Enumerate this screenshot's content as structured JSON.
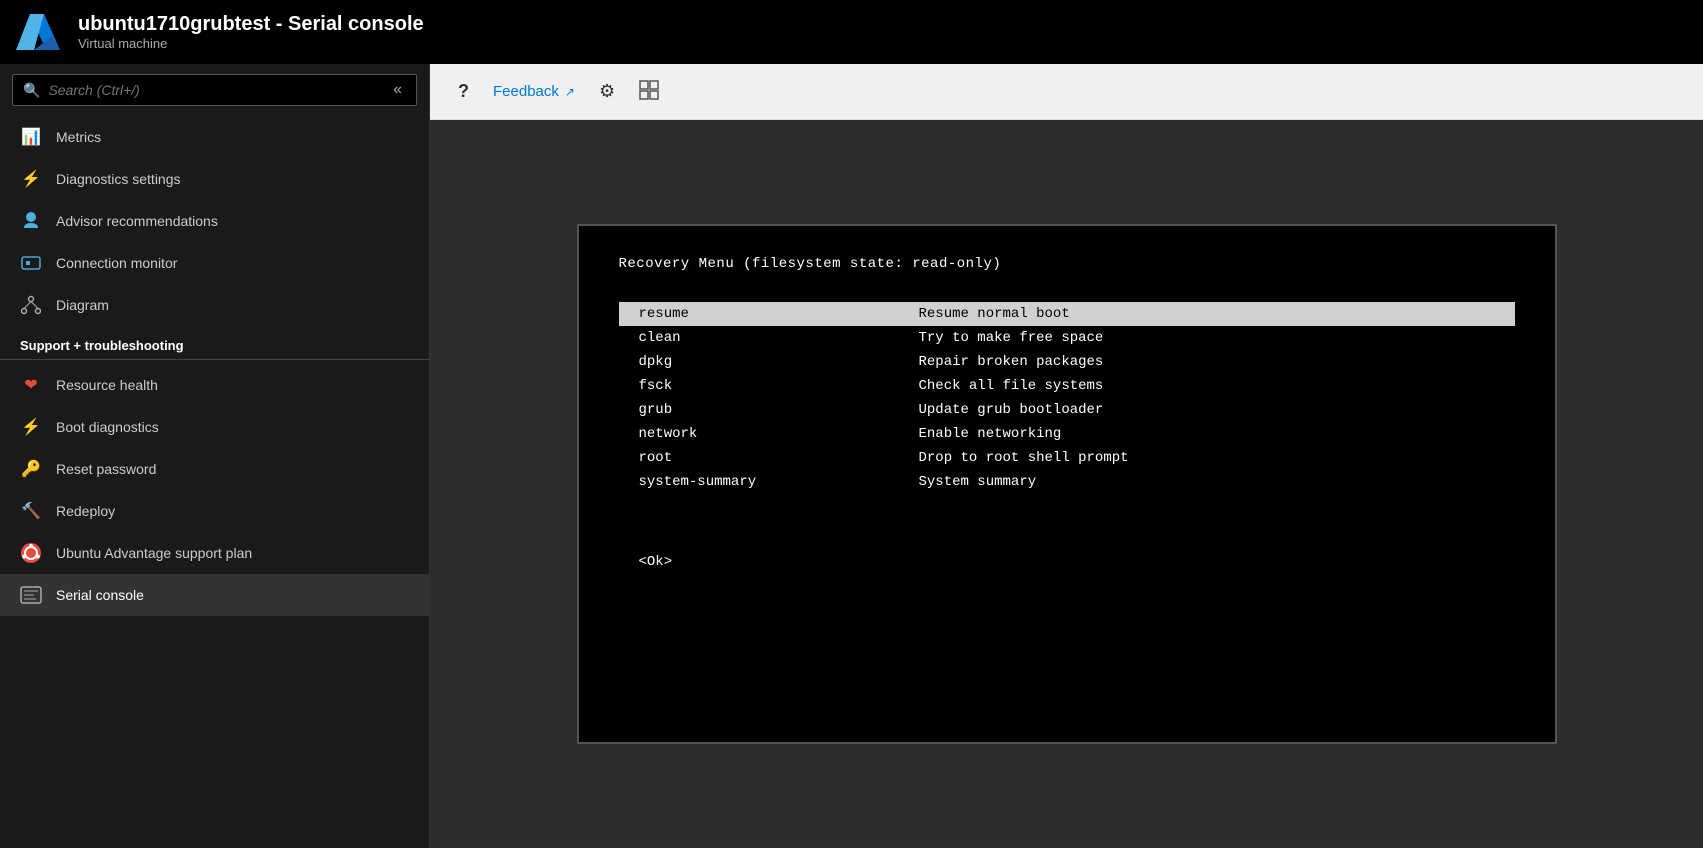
{
  "titleBar": {
    "title": "ubuntu1710grubtest - Serial console",
    "subtitle": "Virtual machine"
  },
  "toolbar": {
    "help_label": "?",
    "feedback_label": "Feedback",
    "settings_icon": "⚙",
    "grid_icon": "⊞"
  },
  "sidebar": {
    "search_placeholder": "Search (Ctrl+/)",
    "items": [
      {
        "id": "metrics",
        "label": "Metrics",
        "icon": "📊",
        "icon_color": "#0078d4"
      },
      {
        "id": "diagnostics",
        "label": "Diagnostics settings",
        "icon": "⚡",
        "icon_color": "#00b294"
      },
      {
        "id": "advisor",
        "label": "Advisor recommendations",
        "icon": "☁",
        "icon_color": "#0078d4"
      },
      {
        "id": "connection",
        "label": "Connection monitor",
        "icon": "🖥",
        "icon_color": "#4da8da"
      },
      {
        "id": "diagram",
        "label": "Diagram",
        "icon": "⚛",
        "icon_color": "#aaa"
      }
    ],
    "section_support": "Support + troubleshooting",
    "support_items": [
      {
        "id": "resource-health",
        "label": "Resource health",
        "icon": "❤",
        "icon_color": "#e74c3c"
      },
      {
        "id": "boot-diagnostics",
        "label": "Boot diagnostics",
        "icon": "⚡",
        "icon_color": "#00b294"
      },
      {
        "id": "reset-password",
        "label": "Reset password",
        "icon": "🔑",
        "icon_color": "#f0c040"
      },
      {
        "id": "redeploy",
        "label": "Redeploy",
        "icon": "🔨",
        "icon_color": "#888"
      },
      {
        "id": "ubuntu-advantage",
        "label": "Ubuntu Advantage support plan",
        "icon": "●",
        "icon_color": "#e74c3c"
      },
      {
        "id": "serial-console",
        "label": "Serial console",
        "icon": "▦",
        "icon_color": "#aaa"
      }
    ]
  },
  "terminal": {
    "title": "Recovery Menu (filesystem state: read-only)",
    "menu_items": [
      {
        "command": "resume",
        "description": "Resume normal boot",
        "selected": true
      },
      {
        "command": "clean",
        "description": "Try to make free space",
        "selected": false
      },
      {
        "command": "dpkg",
        "description": "Repair broken packages",
        "selected": false
      },
      {
        "command": "fsck",
        "description": "Check all file systems",
        "selected": false
      },
      {
        "command": "grub",
        "description": "Update grub bootloader",
        "selected": false
      },
      {
        "command": "network",
        "description": "Enable networking",
        "selected": false
      },
      {
        "command": "root",
        "description": "Drop to root shell prompt",
        "selected": false
      },
      {
        "command": "system-summary",
        "description": "System summary",
        "selected": false
      }
    ],
    "ok_label": "<Ok>"
  }
}
